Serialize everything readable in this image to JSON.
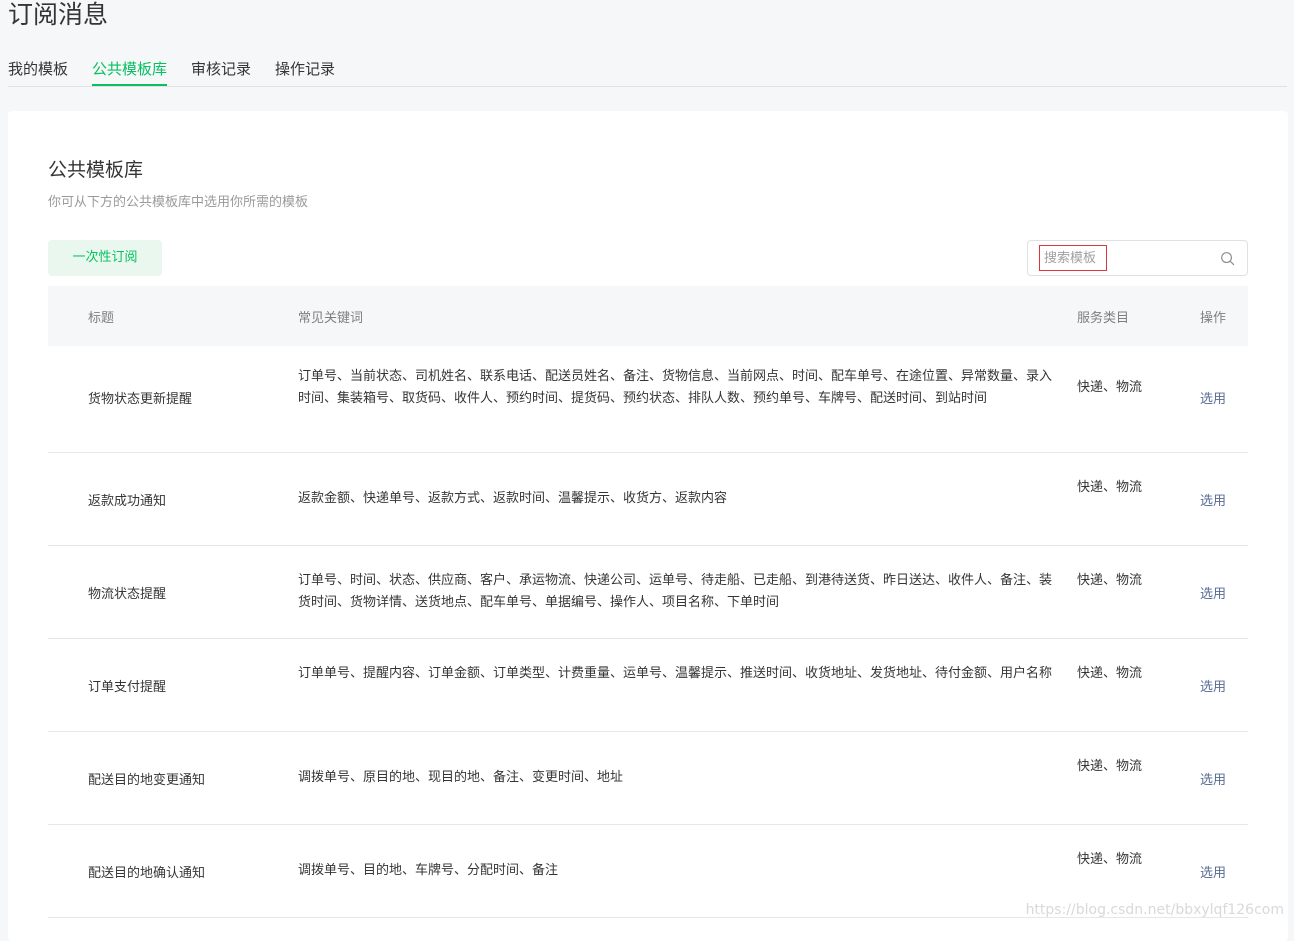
{
  "page": {
    "title": "订阅消息"
  },
  "tabs": [
    {
      "label": "我的模板"
    },
    {
      "label": "公共模板库"
    },
    {
      "label": "审核记录"
    },
    {
      "label": "操作记录"
    }
  ],
  "card": {
    "title": "公共模板库",
    "description": "你可从下方的公共模板库中选用你所需的模板",
    "once_button": "一次性订阅",
    "search_placeholder": "搜索模板"
  },
  "table": {
    "headers": {
      "title": "标题",
      "keywords": "常见关键词",
      "category": "服务类目",
      "action": "操作"
    },
    "rows": [
      {
        "title": "货物状态更新提醒",
        "keywords": "订单号、当前状态、司机姓名、联系电话、配送员姓名、备注、货物信息、当前网点、时间、配车单号、在途位置、异常数量、录入时间、集装箱号、取货码、收件人、预约时间、提货码、预约状态、排队人数、预约单号、车牌号、配送时间、到站时间",
        "category": "快递、物流",
        "action": "选用"
      },
      {
        "title": "返款成功通知",
        "keywords": "返款金额、快递单号、返款方式、返款时间、温馨提示、收货方、返款内容",
        "category": "快递、物流",
        "action": "选用"
      },
      {
        "title": "物流状态提醒",
        "keywords": "订单号、时间、状态、供应商、客户、承运物流、快递公司、运单号、待走船、已走船、到港待送货、昨日送达、收件人、备注、装货时间、货物详情、送货地点、配车单号、单据编号、操作人、项目名称、下单时间",
        "category": "快递、物流",
        "action": "选用"
      },
      {
        "title": "订单支付提醒",
        "keywords": "订单单号、提醒内容、订单金额、订单类型、计费重量、运单号、温馨提示、推送时间、收货地址、发货地址、待付金额、用户名称",
        "category": "快递、物流",
        "action": "选用"
      },
      {
        "title": "配送目的地变更通知",
        "keywords": "调拨单号、原目的地、现目的地、备注、变更时间、地址",
        "category": "快递、物流",
        "action": "选用"
      },
      {
        "title": "配送目的地确认通知",
        "keywords": "调拨单号、目的地、车牌号、分配时间、备注",
        "category": "快递、物流",
        "action": "选用"
      }
    ]
  },
  "watermark": "https://blog.csdn.net/bbxylqf126com",
  "colors": {
    "accent": "#07c160",
    "link": "#576b95"
  }
}
